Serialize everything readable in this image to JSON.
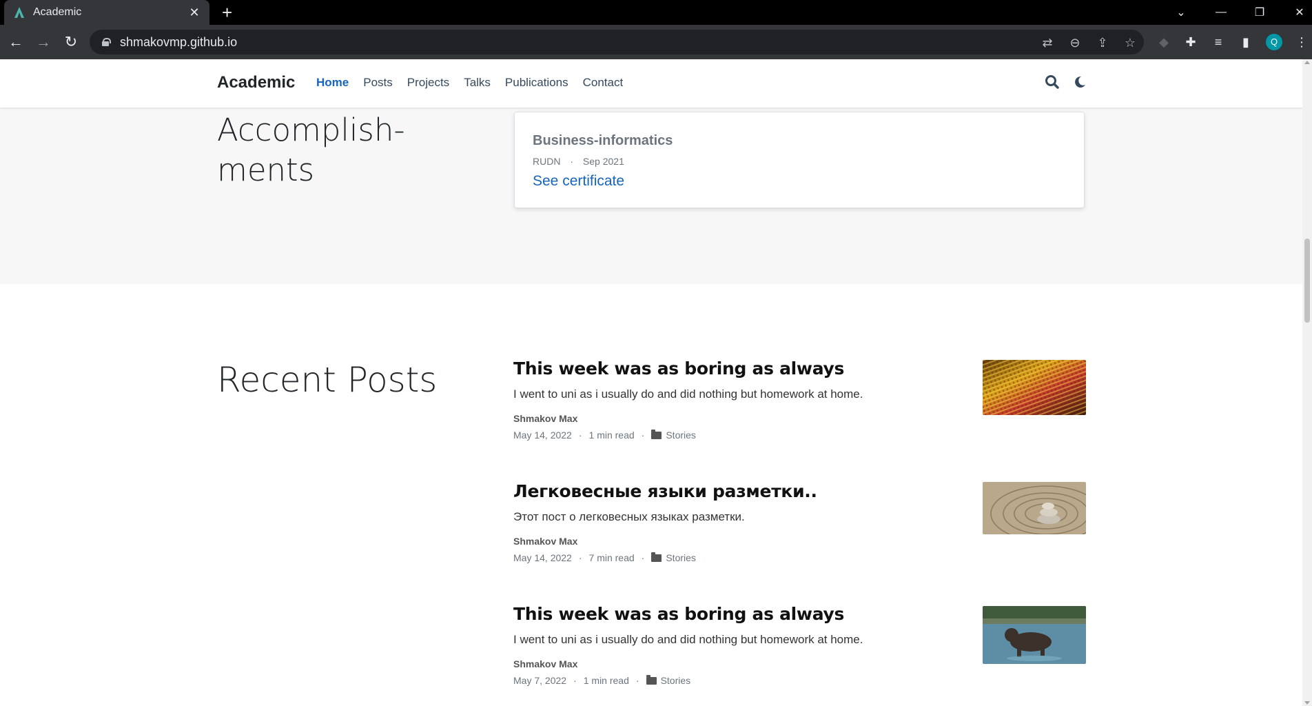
{
  "browser": {
    "tab_title": "Academic",
    "url": "shmakovmp.github.io",
    "profile_initial": "Q",
    "accent_color": "#0097a7"
  },
  "site": {
    "brand": "Academic",
    "nav": [
      {
        "label": "Home",
        "active": true
      },
      {
        "label": "Posts"
      },
      {
        "label": "Projects"
      },
      {
        "label": "Talks"
      },
      {
        "label": "Publications"
      },
      {
        "label": "Contact"
      }
    ],
    "link_color": "#1565c0"
  },
  "accomplishments": {
    "title_line1": "Accomplish-",
    "title_line2": "ments",
    "card": {
      "title": "Business-informatics",
      "org": "RUDN",
      "date": "Sep 2021",
      "link": "See certificate"
    }
  },
  "recent_posts": {
    "title": "Recent Posts",
    "posts": [
      {
        "title": "This week was as boring as always",
        "summary": "I went to uni as i usually do and did nothing but homework at home.",
        "author": "Shmakov Max",
        "date": "May 14, 2022",
        "read_time": "1 min read",
        "category": "Stories",
        "thumb": "colorful-fabric"
      },
      {
        "title": "Легковесные языки разметки..",
        "summary": "Этот пост о легковесных языках разметки.",
        "author": "Shmakov Max",
        "date": "May 14, 2022",
        "read_time": "7 min read",
        "category": "Stories",
        "thumb": "zen-stones"
      },
      {
        "title": "This week was as boring as always",
        "summary": "I went to uni as i usually do and did nothing but homework at home.",
        "author": "Shmakov Max",
        "date": "May 7, 2022",
        "read_time": "1 min read",
        "category": "Stories",
        "thumb": "bear-cub-in-water"
      }
    ]
  }
}
